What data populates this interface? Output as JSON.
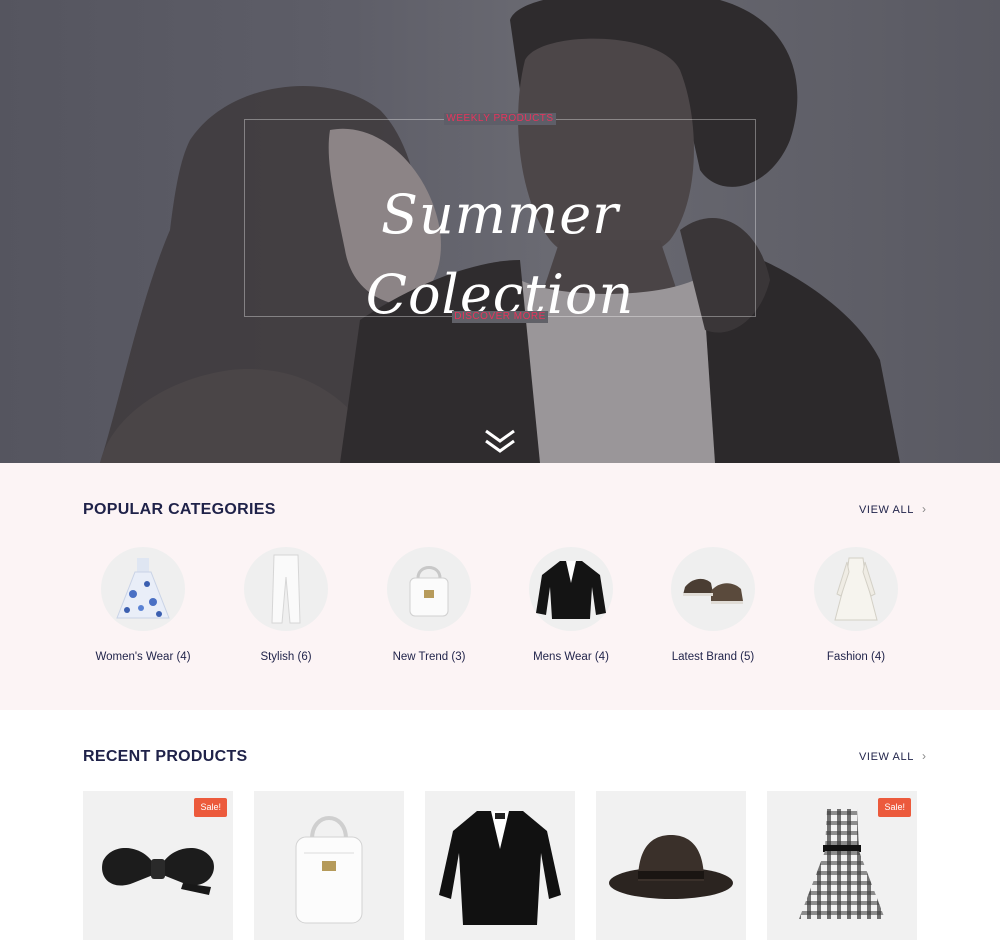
{
  "hero": {
    "eyebrow": "WEEKLY PRODUCTS",
    "title": "Summer Colection",
    "cta": "DISCOVER MORE",
    "scroll_icon": "double-chevron-down-icon",
    "accent_color": "#e8345c"
  },
  "categories": {
    "title_light": "POPULAR",
    "title_bold": "CATEGORIES",
    "view_all": "VIEW ALL",
    "items": [
      {
        "label": "Women's Wear (4)",
        "icon": "floral-dress-icon"
      },
      {
        "label": "Stylish (6)",
        "icon": "white-trousers-icon"
      },
      {
        "label": "New Trend (3)",
        "icon": "white-handbag-icon"
      },
      {
        "label": "Mens Wear (4)",
        "icon": "tuxedo-jacket-icon"
      },
      {
        "label": "Latest Brand (5)",
        "icon": "sneakers-icon"
      },
      {
        "label": "Fashion (4)",
        "icon": "white-dress-icon"
      }
    ]
  },
  "products": {
    "title_light": "RECENT",
    "title_bold": "PRODUCTS",
    "view_all": "VIEW ALL",
    "sale_badge": "Sale!",
    "sale_color": "#ec5a3c",
    "items": [
      {
        "icon": "bow-tie-icon",
        "sale": true
      },
      {
        "icon": "white-backpack-icon",
        "sale": false
      },
      {
        "icon": "tuxedo-jacket-icon",
        "sale": false
      },
      {
        "icon": "fedora-hat-icon",
        "sale": false
      },
      {
        "icon": "plaid-dress-icon",
        "sale": true
      }
    ]
  }
}
